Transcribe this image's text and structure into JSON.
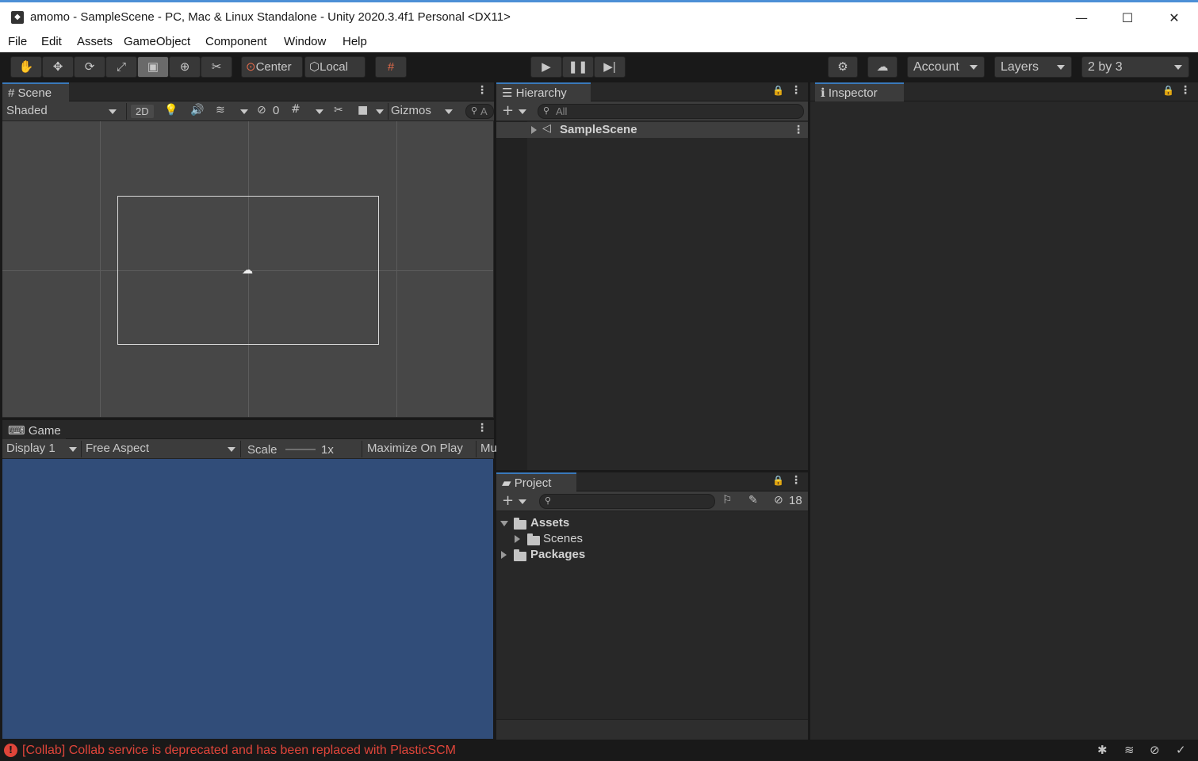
{
  "window": {
    "title": "amomo - SampleScene - PC, Mac & Linux Standalone - Unity 2020.3.4f1 Personal <DX11>",
    "minimize": "—",
    "maximize": "☐",
    "close": "✕"
  },
  "menu": [
    "File",
    "Edit",
    "Assets",
    "GameObject",
    "Component",
    "Window",
    "Help"
  ],
  "toolbar": {
    "pivot": "Center",
    "space": "Local",
    "account": "Account",
    "layers": "Layers",
    "layout": "2 by 3"
  },
  "scene": {
    "tab": "Scene",
    "draw_mode": "Shaded",
    "mode_2d": "2D",
    "hidden_count": "0",
    "gizmos": "Gizmos",
    "search_hint": "A"
  },
  "game": {
    "tab": "Game",
    "display": "Display 1",
    "aspect": "Free Aspect",
    "scale_label": "Scale",
    "scale_value": "1x",
    "maximize": "Maximize On Play",
    "mute": "Mu",
    "background": "#314d79"
  },
  "hierarchy": {
    "tab": "Hierarchy",
    "search_placeholder": "All",
    "root": "SampleScene"
  },
  "inspector": {
    "tab": "Inspector"
  },
  "project": {
    "tab": "Project",
    "hidden_count": "18",
    "assets": "Assets",
    "scenes": "Scenes",
    "packages": "Packages"
  },
  "status": {
    "message": "[Collab] Collab service is deprecated and has been replaced with PlasticSCM",
    "color": "#e0453a"
  },
  "colors": {
    "accent": "#3a79bb",
    "panel": "#282828",
    "bar": "#3c3c3c"
  }
}
